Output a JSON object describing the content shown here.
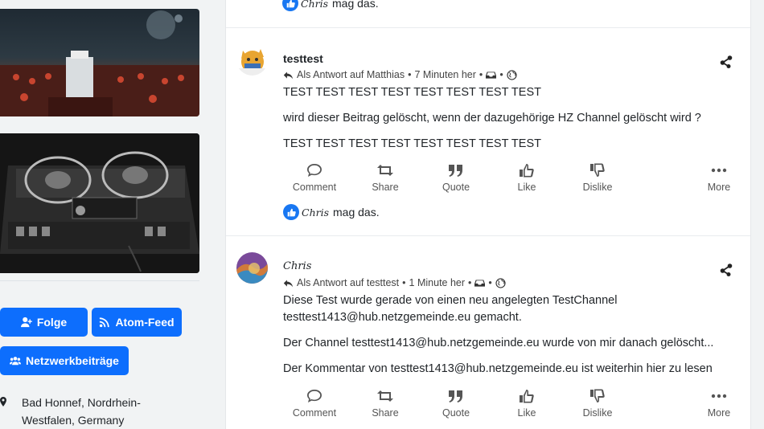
{
  "sidebar": {
    "buttons": {
      "follow": "Folge",
      "atom": "Atom-Feed",
      "network": "Netzwerkbeiträge"
    },
    "location": "Bad Honnef, Nordrhein-Westfalen, Germany"
  },
  "top": {
    "liker": "Chris",
    "likes_text": "mag das."
  },
  "actions": {
    "comment": "Comment",
    "share": "Share",
    "quote": "Quote",
    "like": "Like",
    "dislike": "Dislike",
    "more": "More"
  },
  "posts": [
    {
      "author": "testtest",
      "reply_to": "Als Antwort auf Matthias",
      "time": "7 Minuten her",
      "paragraphs": [
        "TEST TEST TEST TEST TEST TEST TEST TEST",
        "wird dieser Beitrag gelöscht, wenn der dazugehörige HZ Channel gelöscht wird ?",
        "TEST TEST TEST TEST TEST TEST TEST TEST"
      ],
      "liker": "Chris",
      "likes_text": "mag das."
    },
    {
      "author": "Chris",
      "reply_to": "Als Antwort auf testtest",
      "time": "1 Minute her",
      "paragraphs": [
        "Diese Test wurde gerade von einen neu angelegten TestChannel testtest1413@hub.netzgemeinde.eu gemacht.",
        "Der Channel testtest1413@hub.netzgemeinde.eu wurde von mir danach gelöscht...",
        "Der Kommentar von testtest1413@hub.netzgemeinde.eu ist weiterhin hier zu lesen"
      ]
    }
  ],
  "colors": {
    "accent": "#0d6efd",
    "like": "#1877f2"
  }
}
